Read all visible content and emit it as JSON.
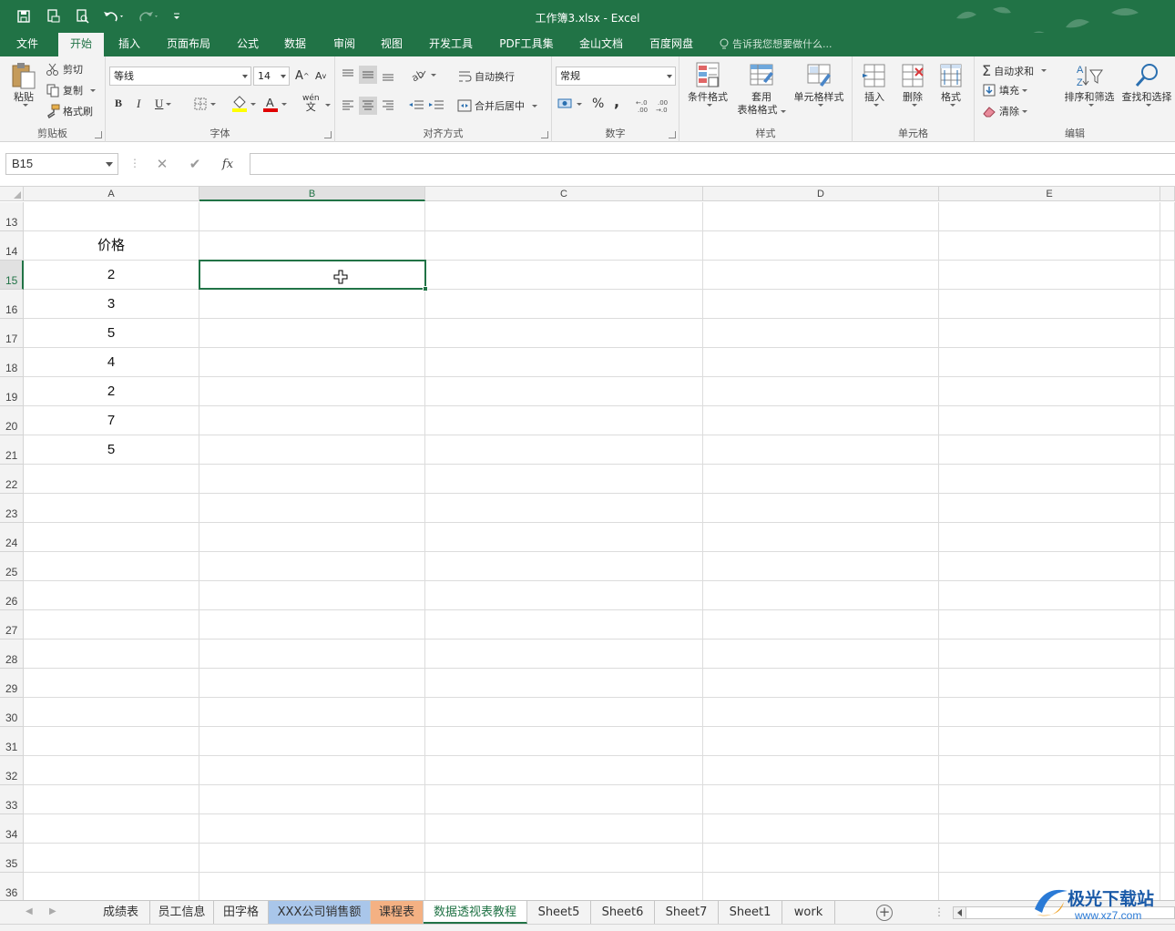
{
  "window": {
    "title": "工作簿3.xlsx - Excel"
  },
  "menu": {
    "tabs": [
      "文件",
      "开始",
      "插入",
      "页面布局",
      "公式",
      "数据",
      "审阅",
      "视图",
      "开发工具",
      "PDF工具集",
      "金山文档",
      "百度网盘"
    ],
    "active_index": 1,
    "tell_me": "告诉我您想要做什么..."
  },
  "ribbon": {
    "clipboard": {
      "group": "剪贴板",
      "paste": "粘贴",
      "cut": "剪切",
      "copy": "复制",
      "format_painter": "格式刷"
    },
    "font": {
      "group": "字体",
      "name": "等线",
      "size": "14",
      "bold": "B",
      "italic": "I",
      "underline": "U",
      "grow": "A",
      "shrink": "A",
      "phonetic": "wén",
      "highlight_color": "#ffff00",
      "font_color": "#e00000"
    },
    "alignment": {
      "group": "对齐方式",
      "wrap": "自动换行",
      "merge": "合并后居中"
    },
    "number": {
      "group": "数字",
      "format": "常规",
      "percent": "%",
      "comma": ","
    },
    "styles": {
      "group": "样式",
      "conditional": "条件格式",
      "table_line1": "套用",
      "table_line2": "表格格式",
      "cell_styles": "单元格样式"
    },
    "cells": {
      "group": "单元格",
      "insert": "插入",
      "delete": "删除",
      "format": "格式"
    },
    "editing": {
      "group": "编辑",
      "autosum": "自动求和",
      "fill": "填充",
      "clear": "清除",
      "sort": "排序和筛选",
      "find": "查找和选择"
    }
  },
  "formula_bar": {
    "name_box": "B15",
    "cancel": "✕",
    "enter": "✔",
    "fx": "fx",
    "value": ""
  },
  "grid": {
    "columns": [
      "A",
      "B",
      "C",
      "D",
      "E"
    ],
    "selected_column": "B",
    "rows": [
      {
        "num": "13",
        "a": ""
      },
      {
        "num": "14",
        "a": "价格"
      },
      {
        "num": "15",
        "a": "2"
      },
      {
        "num": "16",
        "a": "3"
      },
      {
        "num": "17",
        "a": "5"
      },
      {
        "num": "18",
        "a": "4"
      },
      {
        "num": "19",
        "a": "2"
      },
      {
        "num": "20",
        "a": "7"
      },
      {
        "num": "21",
        "a": "5"
      },
      {
        "num": "22",
        "a": ""
      },
      {
        "num": "23",
        "a": ""
      },
      {
        "num": "24",
        "a": ""
      },
      {
        "num": "25",
        "a": ""
      },
      {
        "num": "26",
        "a": ""
      },
      {
        "num": "27",
        "a": ""
      },
      {
        "num": "28",
        "a": ""
      },
      {
        "num": "29",
        "a": ""
      },
      {
        "num": "30",
        "a": ""
      },
      {
        "num": "31",
        "a": ""
      },
      {
        "num": "32",
        "a": ""
      },
      {
        "num": "33",
        "a": ""
      },
      {
        "num": "34",
        "a": ""
      },
      {
        "num": "35",
        "a": ""
      },
      {
        "num": "36",
        "a": ""
      }
    ],
    "selected_row": "15",
    "active_cell": "B15"
  },
  "sheets": {
    "tabs": [
      {
        "name": "成绩表",
        "color": ""
      },
      {
        "name": "员工信息",
        "color": ""
      },
      {
        "name": "田字格",
        "color": ""
      },
      {
        "name": "XXX公司销售额",
        "color": "#a9c6ea"
      },
      {
        "name": "课程表",
        "color": "#f4b183"
      },
      {
        "name": "数据透视表教程",
        "color": ""
      },
      {
        "name": "Sheet5",
        "color": ""
      },
      {
        "name": "Sheet6",
        "color": ""
      },
      {
        "name": "Sheet7",
        "color": ""
      },
      {
        "name": "Sheet1",
        "color": ""
      },
      {
        "name": "work",
        "color": ""
      }
    ],
    "active": "数据透视表教程",
    "add": "+"
  },
  "watermark": {
    "text": "极光下载站",
    "url": "www.xz7.com"
  },
  "colors": {
    "accent": "#217346",
    "ribbon_bg": "#f3f3f3"
  }
}
